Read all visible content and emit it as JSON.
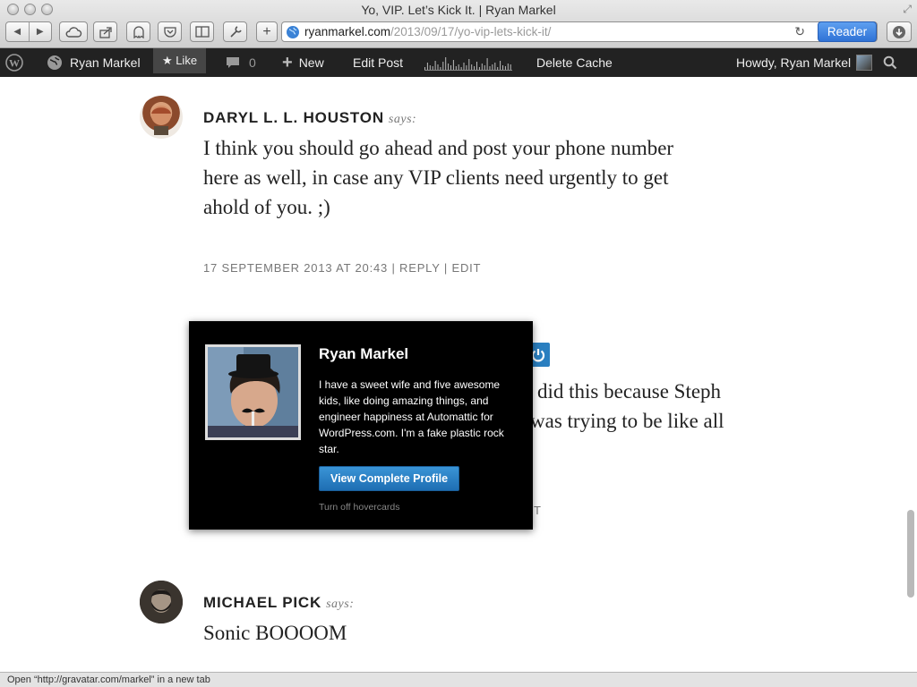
{
  "window": {
    "title": "Yo, VIP. Let’s Kick It. | Ryan Markel"
  },
  "address_bar": {
    "host": "ryanmarkel.com",
    "path": "/2013/09/17/yo-vip-lets-kick-it/",
    "reader_label": "Reader"
  },
  "admin_bar": {
    "site_name": "Ryan Markel",
    "like_label": "★ Like",
    "comments_count": "0",
    "new_label": "New",
    "edit_post_label": "Edit Post",
    "delete_cache_label": "Delete Cache",
    "howdy_label": "Howdy, Ryan Markel"
  },
  "comments": [
    {
      "author": "DARYL L. L. HOUSTON",
      "says": "says:",
      "text_lines": [
        "I think you should go ahead and post your phone number",
        "here as well, in case any VIP clients need urgently to get",
        "ahold of you. ;)"
      ],
      "meta": "17 SEPTEMBER 2013 AT 20:43 | REPLY | EDIT"
    },
    {
      "text_lines": [
        "did this because Steph",
        "was trying to be like all"
      ],
      "meta_tail": "T"
    },
    {
      "author": "MICHAEL PICK",
      "says": "says:",
      "text_lines": [
        "Sonic BOOOOM"
      ]
    }
  ],
  "hovercard": {
    "name": "Ryan Markel",
    "bio_lines": [
      "I have a sweet wife and five awesome",
      "kids, like doing amazing things, and",
      "engineer happiness at Automattic for",
      "WordPress.com. I'm a fake plastic rock",
      "star."
    ],
    "profile_button": "View Complete Profile",
    "turn_off": "Turn off hovercards"
  },
  "status_bar": {
    "text": "Open “http://gravatar.com/markel” in a new tab"
  },
  "colors": {
    "admin_bar_bg": "#222222",
    "reader_button": "#3a82e0",
    "hovercard_bg": "#000000",
    "profile_button": "#2a82c8",
    "power_icon_bg": "#2a7fc0"
  },
  "icons": [
    "wordpress-logo-icon",
    "globe-icon",
    "comment-bubble-icon",
    "plus-icon",
    "search-icon",
    "power-icon",
    "reload-icon"
  ]
}
